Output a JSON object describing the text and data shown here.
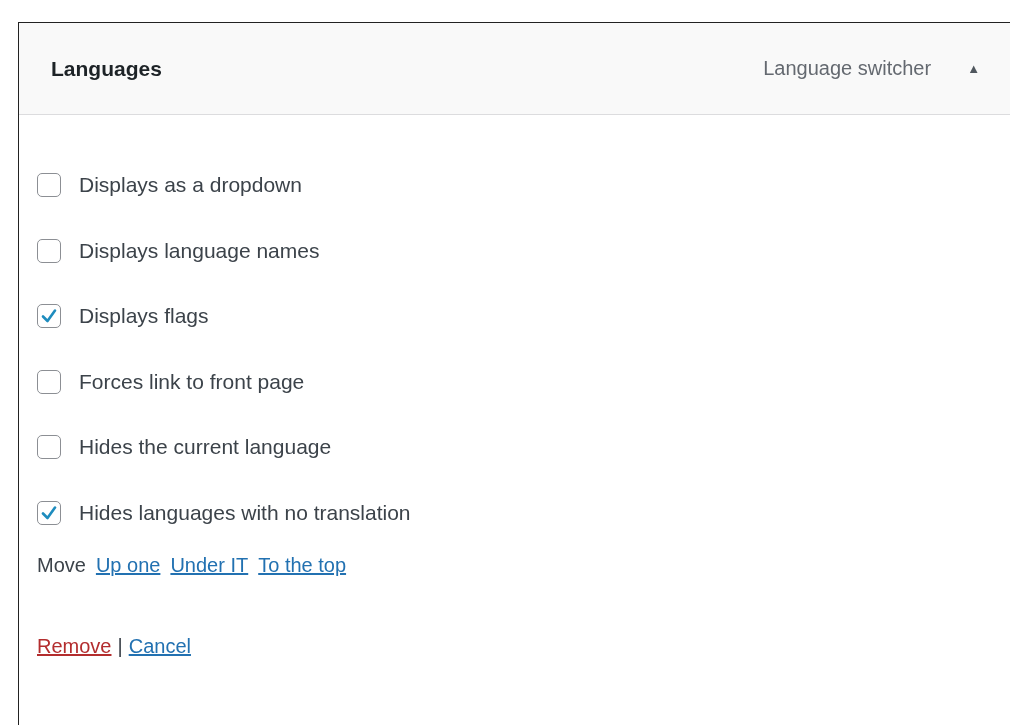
{
  "widget": {
    "title": "Languages",
    "subtitle": "Language switcher",
    "toggle": "▲"
  },
  "options": [
    {
      "label": "Displays as a dropdown",
      "checked": false
    },
    {
      "label": "Displays language names",
      "checked": false
    },
    {
      "label": "Displays flags",
      "checked": true
    },
    {
      "label": "Forces link to front page",
      "checked": false
    },
    {
      "label": "Hides the current language",
      "checked": false
    },
    {
      "label": "Hides languages with no translation",
      "checked": true
    }
  ],
  "move": {
    "label": "Move",
    "links": [
      "Up one",
      "Under IT",
      "To the top"
    ]
  },
  "actions": {
    "remove": "Remove",
    "separator": "|",
    "cancel": "Cancel"
  }
}
